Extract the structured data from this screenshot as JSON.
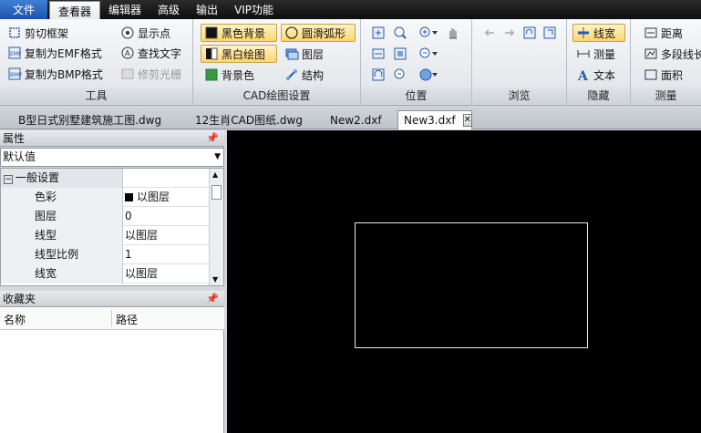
{
  "menu": {
    "items": [
      "文件",
      "查看器",
      "编辑器",
      "高级",
      "输出",
      "VIP功能"
    ],
    "active": "查看器"
  },
  "ribbon": {
    "tools": {
      "label": "工具",
      "buttons": [
        "剪切框架",
        "复制为EMF格式",
        "复制为BMP格式",
        "显示点",
        "查找文字",
        "修剪光栅"
      ]
    },
    "cad": {
      "label": "CAD绘图设置",
      "buttons": [
        "黑色背景",
        "黑白绘图",
        "背景色",
        "圆滑弧形",
        "图层",
        "结构"
      ]
    },
    "position": {
      "label": "位置"
    },
    "browse": {
      "label": "浏览"
    },
    "hide": {
      "label": "隐藏",
      "buttons": [
        "线宽",
        "测量",
        "文本"
      ]
    },
    "measure": {
      "label": "测量",
      "buttons": [
        "距离",
        "多段线长",
        "面积"
      ]
    }
  },
  "tabs": [
    {
      "label": "B型日式别墅建筑施工图.dwg"
    },
    {
      "label": "12生肖CAD图纸.dwg"
    },
    {
      "label": "New2.dxf"
    },
    {
      "label": "New3.dxf",
      "active": true
    }
  ],
  "properties": {
    "title": "属性",
    "combo_value": "默认值",
    "category": "一般设置",
    "rows": [
      {
        "name": "色彩",
        "value": "以图层"
      },
      {
        "name": "图层",
        "value": "0"
      },
      {
        "name": "线型",
        "value": "以图层"
      },
      {
        "name": "线型比例",
        "value": "1"
      },
      {
        "name": "线宽",
        "value": "以图层"
      }
    ]
  },
  "favorites": {
    "title": "收藏夹",
    "columns": [
      "名称",
      "路径"
    ]
  },
  "colors": {
    "canvas": "#000000",
    "shape_stroke": "#e8e8e8",
    "accent": "#1b55a8"
  }
}
